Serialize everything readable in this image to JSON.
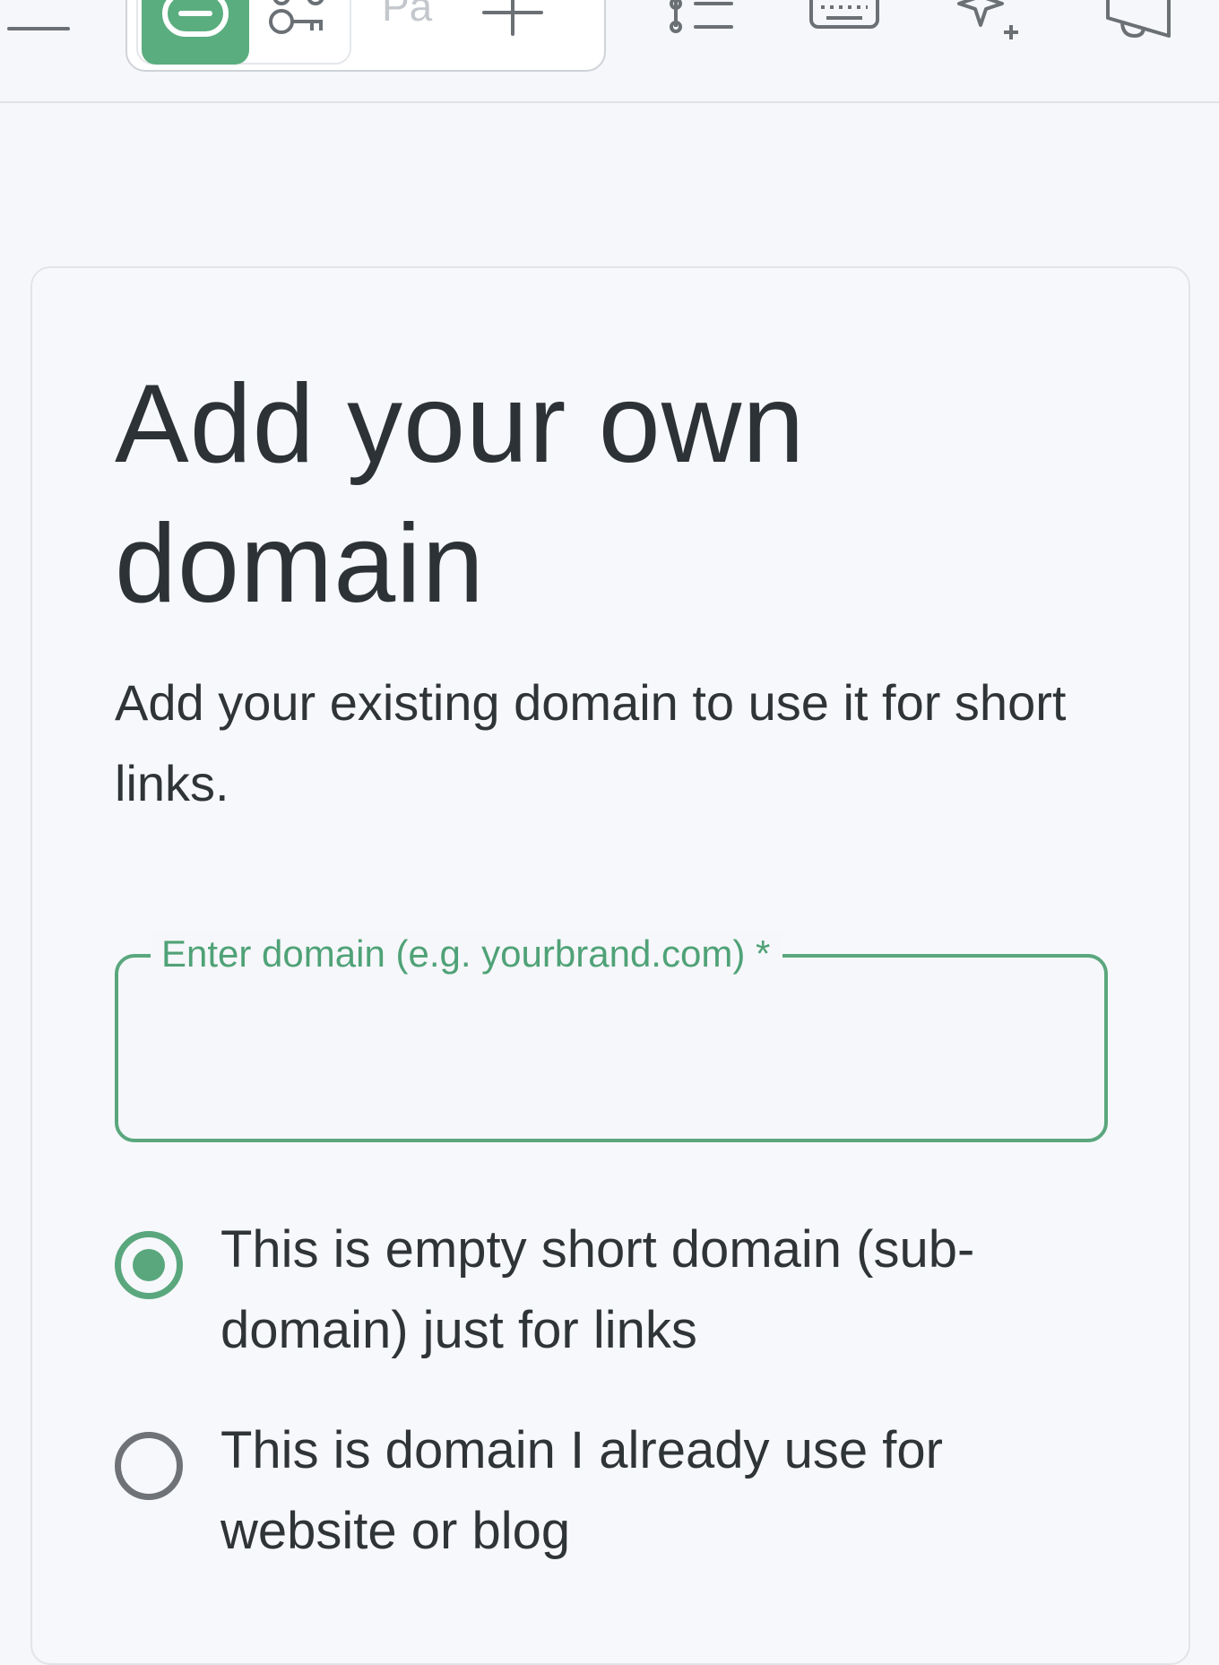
{
  "toolbar": {
    "segment_text": "Pa",
    "icons": {
      "menu": "menu-icon",
      "link": "link-icon",
      "key": "key-icon",
      "add": "plus-icon",
      "list": "list-icon",
      "keyboard": "keyboard-icon",
      "ai": "sparkle-icon",
      "announce": "megaphone-icon"
    }
  },
  "card": {
    "title": "Add your own domain",
    "subtitle": "Add your existing domain to use it for short links.",
    "domain_field": {
      "label": "Enter domain (e.g. yourbrand.com) *",
      "value": ""
    },
    "options": [
      {
        "label": "This is empty short domain (sub-domain) just for links",
        "selected": true
      },
      {
        "label": "This is domain I already use for website or blog",
        "selected": false
      }
    ]
  },
  "colors": {
    "accent": "#5aa77e",
    "text": "#2f3437",
    "background": "#f6f7fa",
    "radio_unchecked": "#6f7377"
  }
}
